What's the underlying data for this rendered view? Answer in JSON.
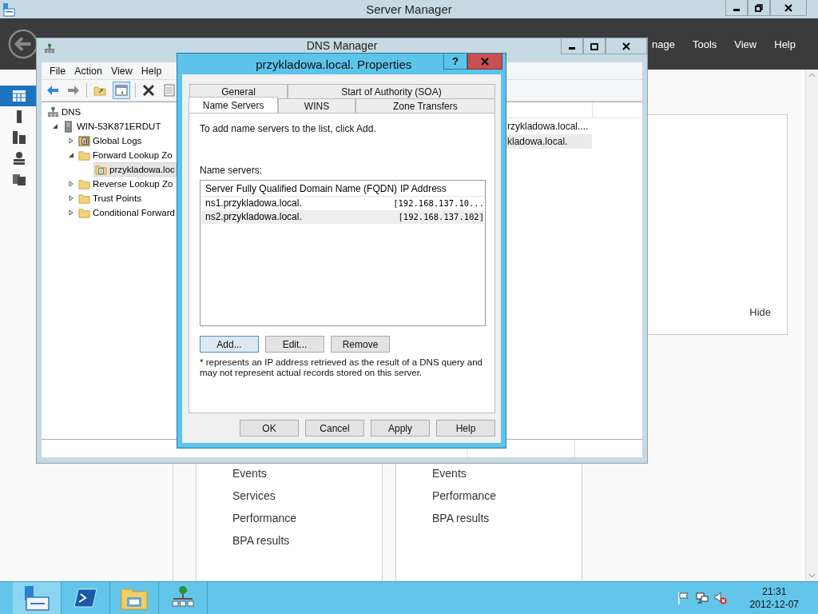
{
  "server_manager": {
    "title": "Server Manager",
    "menu": [
      "nage",
      "Tools",
      "View",
      "Help"
    ],
    "sidebar": [
      {
        "kind": "dashboard",
        "selected": true
      },
      {
        "kind": "local",
        "selected": false
      },
      {
        "kind": "all",
        "selected": false
      },
      {
        "kind": "dns",
        "selected": false
      },
      {
        "kind": "files",
        "selected": false
      }
    ],
    "hide_label": "Hide",
    "tiles": [
      {
        "links": [
          "Events",
          "Services",
          "Performance",
          "BPA results"
        ]
      },
      {
        "links": [
          "Events",
          "Performance",
          "BPA results"
        ]
      }
    ]
  },
  "dns_manager": {
    "title": "DNS Manager",
    "menu": [
      "File",
      "Action",
      "View",
      "Help"
    ],
    "tree": [
      {
        "label": "DNS",
        "kind": "dns",
        "selected": false,
        "children": [
          {
            "label": "WIN-53K871ERDUT",
            "kind": "server",
            "selected": false,
            "expanded": true,
            "children": [
              {
                "label": "Global Logs",
                "kind": "logs",
                "selected": false,
                "expanded": false
              },
              {
                "label": "Forward Lookup Zo",
                "kind": "folder",
                "selected": false,
                "expanded": true,
                "children": [
                  {
                    "label": "przykladowa.loc",
                    "kind": "zone",
                    "selected": true
                  }
                ]
              },
              {
                "label": "Reverse Lookup Zo",
                "kind": "folder",
                "selected": false,
                "expanded": false
              },
              {
                "label": "Trust Points",
                "kind": "folder",
                "selected": false,
                "expanded": false
              },
              {
                "label": "Conditional Forward",
                "kind": "folder",
                "selected": false,
                "expanded": false
              }
            ]
          }
        ]
      }
    ],
    "records": [
      {
        "text": "rzykladowa.local....",
        "selected": false
      },
      {
        "text": "kladowa.local.",
        "selected": true
      }
    ]
  },
  "dialog": {
    "title": "przykladowa.local. Properties",
    "help": "?",
    "tab_rows": [
      [
        {
          "label": "General",
          "selected": false
        },
        {
          "label": "Start of Authority (SOA)",
          "selected": false
        }
      ],
      [
        {
          "label": "Name Servers",
          "selected": true
        },
        {
          "label": "WINS",
          "selected": false
        },
        {
          "label": "Zone Transfers",
          "selected": false
        }
      ]
    ],
    "intro": "To add name servers to the list, click Add.",
    "list_label": "Name servers:",
    "columns": [
      "Server Fully Qualified Domain Name (FQDN)",
      "IP Address"
    ],
    "rows": [
      {
        "fqdn": "ns1.przykladowa.local.",
        "ip": "[192.168.137.10...",
        "selected": false
      },
      {
        "fqdn": "ns2.przykladowa.local.",
        "ip": "[192.168.137.102]",
        "selected": true
      }
    ],
    "list_buttons": [
      {
        "label": "Add...",
        "focused": true
      },
      {
        "label": "Edit...",
        "focused": false
      },
      {
        "label": "Remove",
        "focused": false
      }
    ],
    "note": "* represents an IP address retrieved as the result of a DNS query and may not represent actual records stored on this server.",
    "buttons": [
      "OK",
      "Cancel",
      "Apply",
      "Help"
    ]
  },
  "taskbar": {
    "apps": [
      {
        "kind": "server-manager",
        "selected": true
      },
      {
        "kind": "powershell",
        "selected": false
      },
      {
        "kind": "explorer",
        "selected": false
      },
      {
        "kind": "dns",
        "selected": false
      }
    ],
    "tray": [
      {
        "kind": "flag"
      },
      {
        "kind": "network"
      },
      {
        "kind": "speaker-muted"
      }
    ],
    "time": "21:31",
    "date": "2012-12-07"
  }
}
